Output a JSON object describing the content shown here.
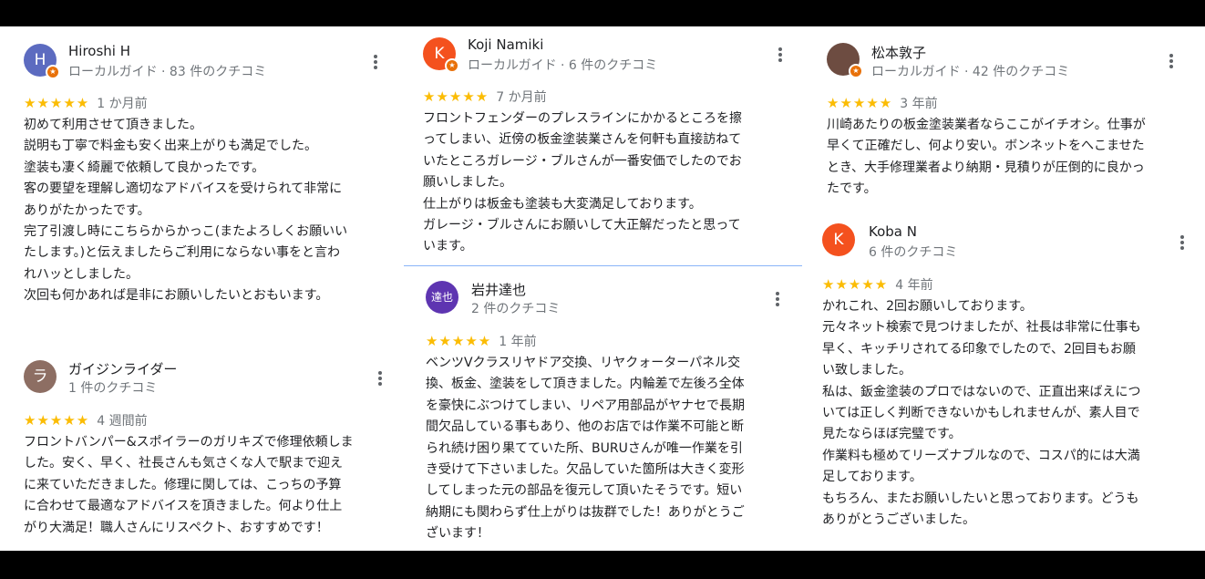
{
  "reviews": [
    {
      "author": "Hiroshi H",
      "meta": "ローカルガイド · 83 件のクチコミ",
      "avatar_letter": "H",
      "avatar_color": "#5c6bc0",
      "local_guide": true,
      "stars": "★★★★★",
      "rating": 5,
      "time": "1 か月前",
      "text": "初めて利用させて頂きました。\n説明も丁寧で料金も安く出来上がりも満足でした。\n塗装も凄く綺麗で依頼して良かったです。\n客の要望を理解し適切なアドバイスを受けられて非常に\nありがたかったです。\n完了引渡し時にこちらからかっこ(またよろしくお願いい\nたします。)と伝えましたらご利用にならない事をと言わ\nれハッとしました。\n次回も何かあれば是非にお願いしたいとおもいます。"
    },
    {
      "author": "ガイジンライダー",
      "meta": "1 件のクチコミ",
      "avatar_letter": "ラ",
      "avatar_color": "#8d6e63",
      "local_guide": false,
      "stars": "★★★★★",
      "rating": 5,
      "time": "4 週間前",
      "text": "フロントバンパー&スポイラーのガリキズで修理依頼しま\nした。安く、早く、社長さんも気さくな人で駅まで迎え\nに来ていただきました。修理に関しては、こっちの予算\nに合わせて最適なアドバイスを頂きました。何より仕上\nがり大満足！職人さんにリスペクト、おすすめです！"
    },
    {
      "author": "Koji Namiki",
      "meta": "ローカルガイド · 6 件のクチコミ",
      "avatar_letter": "K",
      "avatar_color": "#f4511e",
      "local_guide": true,
      "stars": "★★★★★",
      "rating": 5,
      "time": "7 か月前",
      "text": "フロントフェンダーのプレスラインにかかるところを擦\nってしまい、近傍の板金塗装業さんを何軒も直接訪ねて\nいたところガレージ・ブルさんが一番安価でしたのでお\n願いしました。\n仕上がりは板金も塗装も大変満足しております。\nガレージ・ブルさんにお願いして大正解だったと思って\nいます。"
    },
    {
      "author": "岩井達也",
      "meta": "2 件のクチコミ",
      "avatar_letter": "達也",
      "avatar_color": "#5e35b1",
      "local_guide": false,
      "stars": "★★★★★",
      "rating": 5,
      "time": "1 年前",
      "text": "ベンツVクラスリヤドア交換、リヤクォーターパネル交\n換、板金、塗装をして頂きました。内輪差で左後ろ全体\nを豪快にぶつけてしまい、リペア用部品がヤナセで長期\n間欠品している事もあり、他のお店では作業不可能と断\nられ続け困り果てていた所、BURUさんが唯一作業を引\nき受けて下さいました。欠品していた箇所は大きく変形\nしてしまった元の部品を復元して頂いたそうです。短い\n納期にも関わらず仕上がりは抜群でした！ありがとうご\nざいます！"
    },
    {
      "author": "松本敦子",
      "meta": "ローカルガイド · 42 件のクチコミ",
      "avatar_letter": "",
      "avatar_color": "#6d4c41",
      "local_guide": true,
      "stars": "★★★★★",
      "rating": 5,
      "time": "3 年前",
      "text": "川崎あたりの板金塗装業者ならここがイチオシ。仕事が\n早くて正確だし、何より安い。ボンネットをへこませた\nとき、大手修理業者より納期・見積りが圧倒的に良かっ\nたです。"
    },
    {
      "author": "Koba N",
      "meta": "6 件のクチコミ",
      "avatar_letter": "K",
      "avatar_color": "#f4511e",
      "local_guide": false,
      "stars": "★★★★★",
      "rating": 5,
      "time": "4 年前",
      "text": "かれこれ、2回お願いしております。\n元々ネット検索で見つけましたが、社長は非常に仕事も\n早く、キッチリされてる印象でしたので、2回目もお願\nい致しました。\n私は、鈑金塗装のプロではないので、正直出来ばえにつ\nいては正しく判断できないかもしれませんが、素人目で\n見たならほぼ完璧です。\n作業料も極めてリーズナブルなので、コスパ的には大満\n足しております。\nもちろん、またお願いしたいと思っております。どうも\nありがとうございました。"
    }
  ]
}
